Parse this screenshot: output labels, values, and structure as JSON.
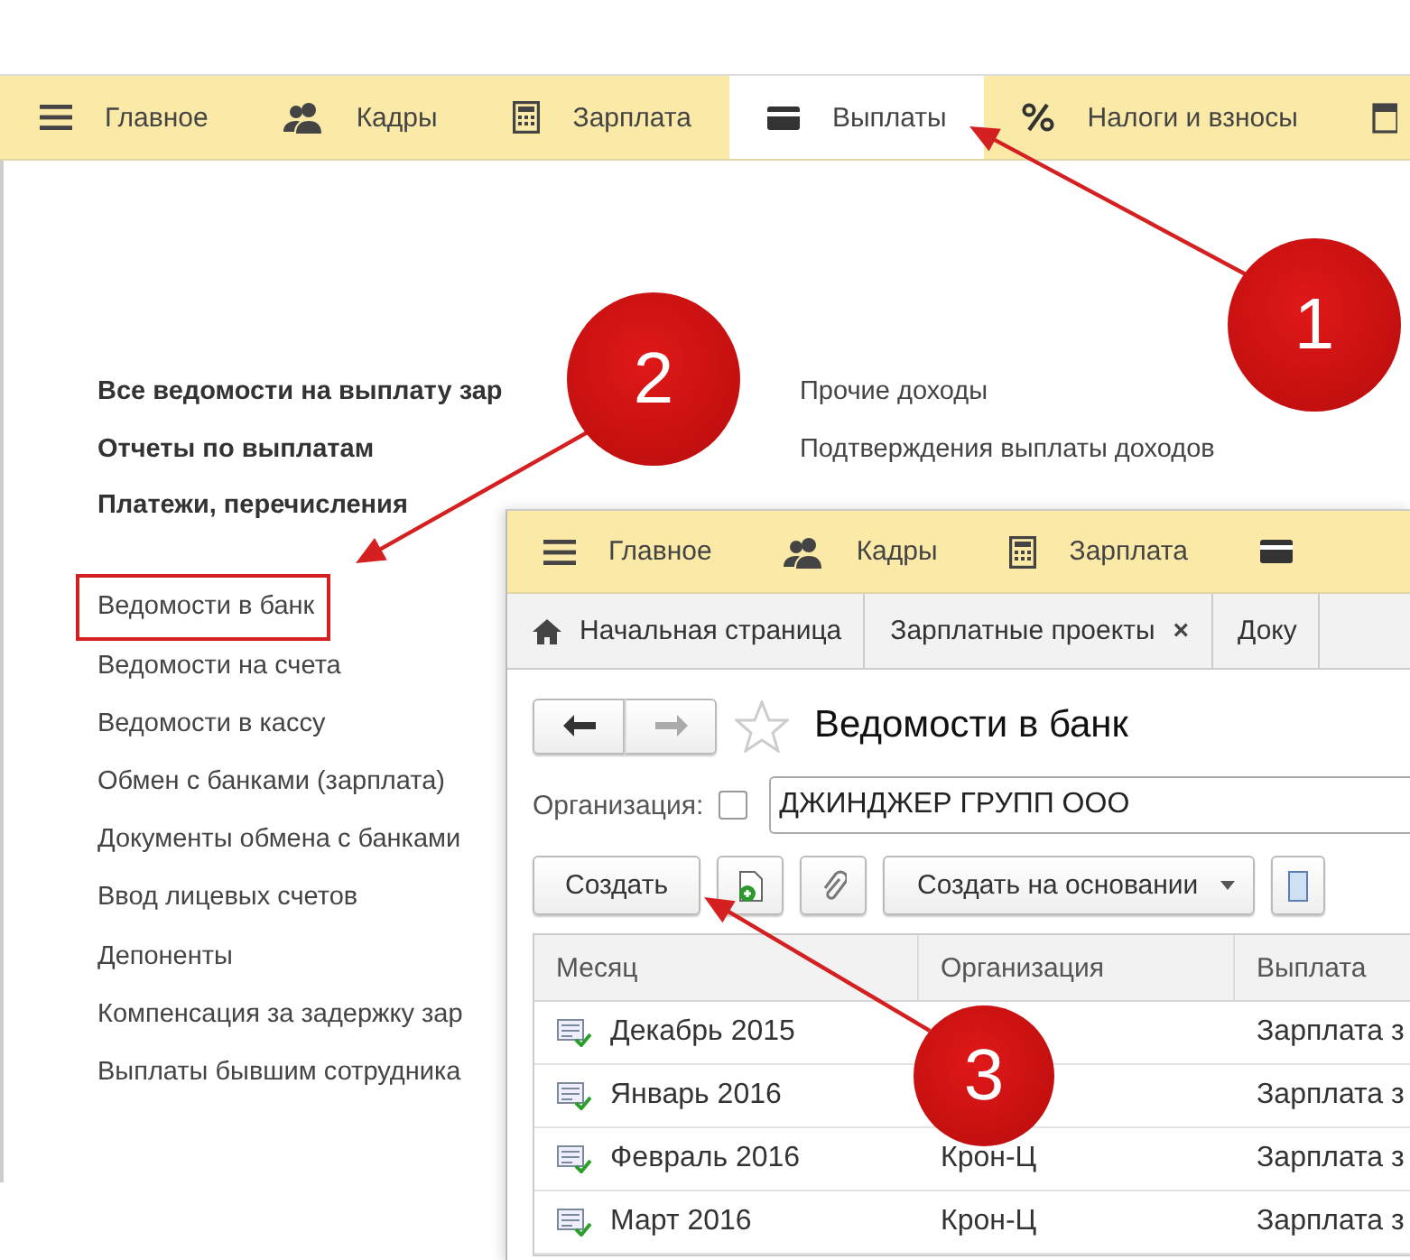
{
  "main_window": {
    "sections": [
      {
        "label": "Главное",
        "selected": false
      },
      {
        "label": "Кадры",
        "selected": false
      },
      {
        "label": "Зарплата",
        "selected": false
      },
      {
        "label": "Выплаты",
        "selected": true
      },
      {
        "label": "Налоги и взносы",
        "selected": false
      }
    ],
    "bold_links": [
      "Все ведомости на выплату зар",
      "Отчеты по выплатам",
      "Платежи, перечисления"
    ],
    "right_links": [
      "Прочие доходы",
      "Подтверждения выплаты доходов"
    ],
    "links": [
      {
        "label": "Ведомости в банк",
        "boxed": true
      },
      {
        "label": "Ведомости на счета",
        "boxed": false
      },
      {
        "label": "Ведомости в кассу",
        "boxed": false
      },
      {
        "label": "Обмен с банками (зарплата)",
        "boxed": false
      },
      {
        "label": "Документы обмена с банками",
        "boxed": false
      },
      {
        "label": "Ввод лицевых счетов",
        "boxed": false
      },
      {
        "label": "Депоненты",
        "boxed": false
      },
      {
        "label": "Компенсация за задержку зар",
        "boxed": false
      },
      {
        "label": "Выплаты бывшим сотрудника",
        "boxed": false
      }
    ]
  },
  "list_window": {
    "sections": [
      "Главное",
      "Кадры",
      "Зарплата"
    ],
    "tabs": [
      {
        "label": "Начальная страница",
        "kind": "home"
      },
      {
        "label": "Зарплатные проекты",
        "kind": "closable",
        "close": "×"
      },
      {
        "label": "Доку",
        "kind": "plain"
      }
    ],
    "title": "Ведомости в банк",
    "filter": {
      "label": "Организация:",
      "checked": false,
      "value": "ДЖИНДЖЕР ГРУПП ООО"
    },
    "buttons": [
      {
        "kind": "text",
        "label": "Создать"
      },
      {
        "kind": "add-document"
      },
      {
        "kind": "attach"
      },
      {
        "kind": "dropdown",
        "label": "Создать на основании"
      },
      {
        "kind": "report"
      }
    ],
    "table": {
      "columns": [
        "Месяц",
        "Организация",
        "Выплата"
      ],
      "rows": [
        [
          "Декабрь 2015",
          "",
          "Зарплата з"
        ],
        [
          "Январь 2016",
          "",
          "Зарплата з"
        ],
        [
          "Февраль 2016",
          "Крон-Ц",
          "Зарплата з"
        ],
        [
          "Март 2016",
          "Крон-Ц",
          "Зарплата з"
        ]
      ]
    }
  },
  "callouts": [
    "1",
    "2",
    "3"
  ]
}
